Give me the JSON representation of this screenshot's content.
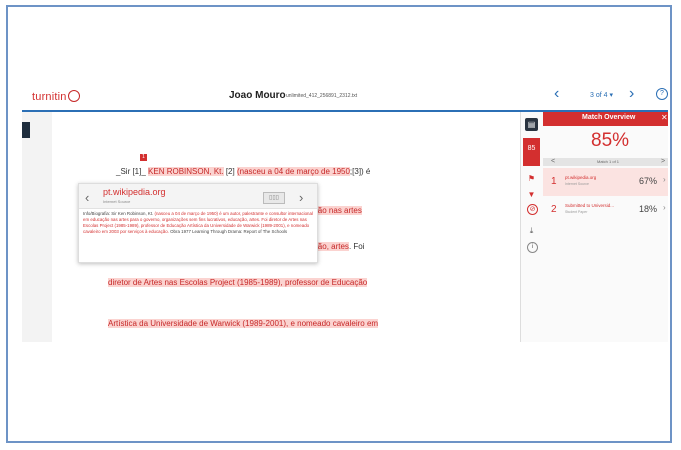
{
  "header": {
    "logo": "turnitin",
    "author": "Joao Mouro",
    "filename": "unlimited_412_256891_2312.txt",
    "page_indicator": "3 of 4 ▾",
    "nav_prev": "‹",
    "nav_next": "›",
    "help": "?"
  },
  "document": {
    "marker": "1",
    "line1_plain": "_Sir [1]_",
    "line1_name": "KEN ROBINSON, Kt.",
    "line1_ref": " [2] ",
    "line1_hl": "(nasceu a 04 de março de 1950",
    "line1_end": ";[3]) é",
    "line2": "educação nas artes",
    "line3_hl": "educação, artes",
    "line3_end": ". Foi",
    "line4": "diretor de Artes nas Escolas Project (1985-1989), professor de Educação",
    "line5": "Artística da Universidade de Warwick (1989-2001), e nomeado cavaleiro em"
  },
  "popup": {
    "domain": "pt.wikipedia.org",
    "source_type": "Internet Source",
    "book_icon": "▯▯▯",
    "prev": "‹",
    "next": "›",
    "text_prefix": "Info/Biografia: Sir Ken Robinson, Kt. ",
    "text_match": "(nasceu a 04 de março de 1950) é um autor, palestrante e consultor internacional em educação nas artes para o governo, organizações sem fins lucrativos, educação, artes. Foi diretor de Artes nas Escolas Project (1985-1989), professor de Educação Artística da Universidade de Warwick (1989-2001), e nomeado cavaleiro em 2003 por serviços à educação.",
    "text_suffix": " Obra 1977 Learning Through Drama: Report of The Schools"
  },
  "toolbar": {
    "layers_icon": "▤",
    "score": "85",
    "flag_icon": "⚑",
    "filter_icon": "▼",
    "ban_icon": "⊘",
    "download_icon": "⤓",
    "info_icon": "i"
  },
  "match_overview": {
    "title": "Match Overview",
    "close": "✕",
    "percentage": "85%",
    "match_label": "Match 1 of 1",
    "prev": "<",
    "next": ">",
    "matches": [
      {
        "num": "1",
        "name": "pt.wikipedia.org",
        "type": "Internet Source",
        "pct": "67%",
        "chev": "›"
      },
      {
        "num": "2",
        "name": "Submitted to Universid...",
        "type": "Student Paper",
        "pct": "18%",
        "chev": "›"
      }
    ]
  },
  "colors": {
    "accent_red": "#d32f2f",
    "highlight": "#fbd3d0",
    "nav_blue": "#2b6fb5",
    "frame_blue": "#6d93c6"
  }
}
